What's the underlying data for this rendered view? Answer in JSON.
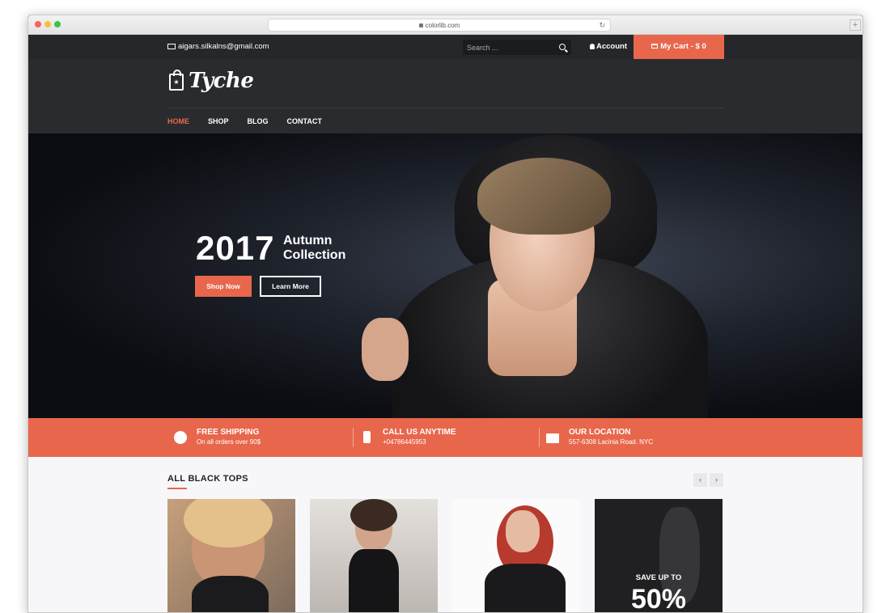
{
  "browser": {
    "url": "colorlib.com",
    "newtab_label": "+"
  },
  "topbar": {
    "email": "aigars.silkalns@gmail.com",
    "search_placeholder": "Search ...",
    "account_label": "Account",
    "cart_label": "My Cart - $ 0"
  },
  "header": {
    "logo_text": "Tyche"
  },
  "nav": {
    "items": [
      "HOME",
      "SHOP",
      "BLOG",
      "CONTACT"
    ],
    "active": "HOME"
  },
  "hero": {
    "year": "2017",
    "title": "Autumn Collection",
    "primary_button": "Shop Now",
    "secondary_button": "Learn More"
  },
  "features": [
    {
      "icon": "globe-icon",
      "title": "FREE SHIPPING",
      "subtitle": "On all orders over 90$"
    },
    {
      "icon": "phone-icon",
      "title": "CALL US ANYTIME",
      "subtitle": "+04786445953"
    },
    {
      "icon": "map-icon",
      "title": "OUR LOCATION",
      "subtitle": "557-6308 Lacinia Road. NYC"
    }
  ],
  "products": {
    "section_title": "ALL BLACK TOPS",
    "prev_arrow": "‹",
    "next_arrow": "›",
    "promo_line": "SAVE UP TO",
    "promo_value": "50%"
  },
  "colors": {
    "accent": "#e8674c",
    "topbar": "#26272b",
    "header": "#2a2b2f"
  }
}
